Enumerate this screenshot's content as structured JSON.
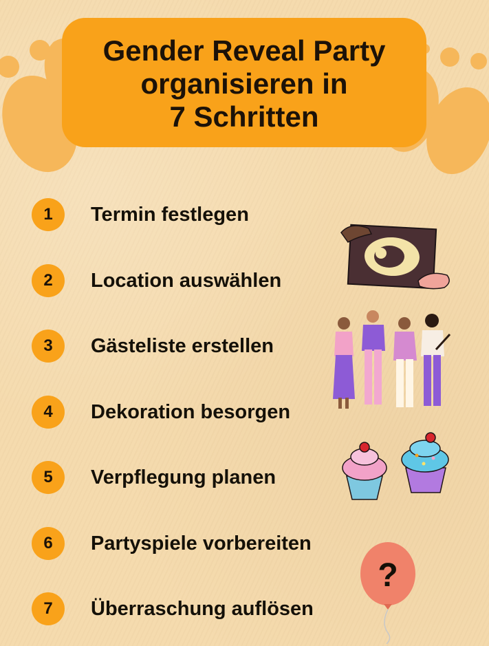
{
  "title": {
    "line1": "Gender Reveal Party",
    "line2": "organisieren in",
    "line3": "7 Schritten"
  },
  "steps": [
    {
      "number": "1",
      "label": "Termin festlegen"
    },
    {
      "number": "2",
      "label": "Location auswählen"
    },
    {
      "number": "3",
      "label": "Gästeliste erstellen"
    },
    {
      "number": "4",
      "label": "Dekoration besorgen"
    },
    {
      "number": "5",
      "label": "Verpflegung planen"
    },
    {
      "number": "6",
      "label": "Partyspiele vorbereiten"
    },
    {
      "number": "7",
      "label": "Überraschung auflösen"
    }
  ],
  "colors": {
    "background": "#f5dbae",
    "accent": "#f9a21a",
    "footprint": "#f6b75a",
    "text": "#141008",
    "balloon": "#f0826a"
  },
  "icons": [
    "footprints-icon",
    "ultrasound-icon",
    "people-group-icon",
    "cupcake-icon",
    "question-balloon-icon"
  ]
}
